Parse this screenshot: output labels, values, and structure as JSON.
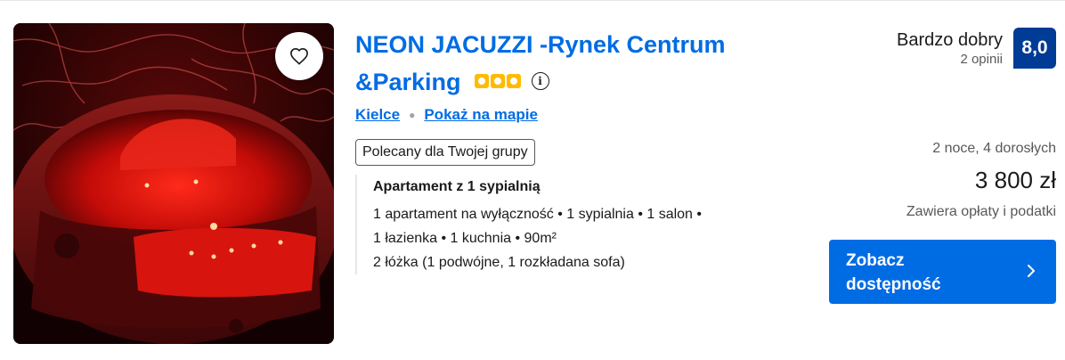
{
  "property": {
    "name": "NEON JACUZZI -Rynek Centrum &Parking",
    "star_rating": 3,
    "info_glyph": "i",
    "city": "Kielce",
    "map_link": "Pokaż na mapie",
    "group_badge": "Polecany dla Twojej grupy",
    "favorite_icon": "heart-outline-icon"
  },
  "unit": {
    "name": "Apartament z 1 sypialnią",
    "details": [
      "1 apartament na wyłączność • 1 sypialnia • 1 salon •",
      "1 łazienka • 1 kuchnia • 90m²",
      "2 łóżka (1 podwójne, 1 rozkładana sofa)"
    ]
  },
  "review": {
    "label": "Bardzo dobry",
    "count": "2 opinii",
    "score": "8,0"
  },
  "pricing": {
    "stay": "2 noce, 4 dorosłych",
    "price": "3 800 zł",
    "taxes": "Zawiera opłaty i podatki"
  },
  "cta": {
    "line1": "Zobacz",
    "line2": "dostępność",
    "icon": "chevron-right-icon"
  },
  "colors": {
    "link_blue": "#006ce4",
    "score_navy": "#003b95",
    "star_yellow": "#febb02"
  }
}
